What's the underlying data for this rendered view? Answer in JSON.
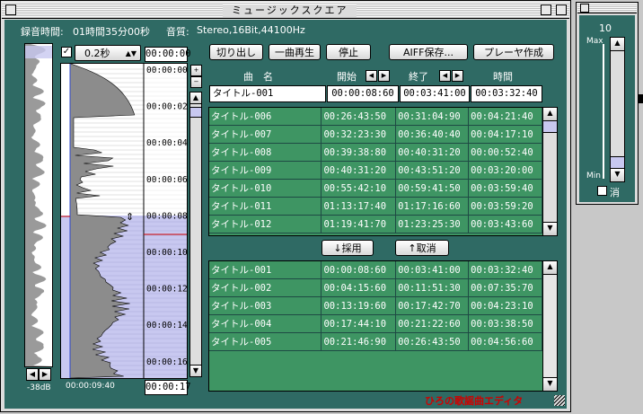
{
  "window": {
    "title": "ミュージックスクエア"
  },
  "info": {
    "record_label": "録音時間:",
    "record_value": "01時間35分00秒",
    "quality_label": "音質:",
    "quality_value": "Stereo,16Bit,44100Hz"
  },
  "interval": {
    "value": "0.2秒",
    "checked": true
  },
  "toolbar": {
    "cut": "切り出し",
    "play_one": "一曲再生",
    "stop": "停止",
    "save_aiff": "AIFF保存...",
    "make_player": "プレーヤ作成"
  },
  "headers": {
    "name": "曲　名",
    "start": "開始",
    "end": "終了",
    "time": "時間"
  },
  "editor": {
    "name": "タイトル-001",
    "start": "00:00:08:60",
    "end": "00:03:41:00",
    "time": "00:03:32:40"
  },
  "timeline": {
    "labels": [
      "00:00:00",
      "00:00:02",
      "00:00:04",
      "00:00:06",
      "00:00:08",
      "00:00:10",
      "00:00:12",
      "00:00:14",
      "00:00:16"
    ],
    "top_time": "00:00:00",
    "bottom_time": "00:00:17",
    "cursor_time": "00:00:09:40",
    "db": "-38dB"
  },
  "upper_list": [
    {
      "name": "タイトル-006",
      "start": "00:26:43:50",
      "end": "00:31:04:90",
      "time": "00:04:21:40"
    },
    {
      "name": "タイトル-007",
      "start": "00:32:23:30",
      "end": "00:36:40:40",
      "time": "00:04:17:10"
    },
    {
      "name": "タイトル-008",
      "start": "00:39:38:80",
      "end": "00:40:31:20",
      "time": "00:00:52:40"
    },
    {
      "name": "タイトル-009",
      "start": "00:40:31:20",
      "end": "00:43:51:20",
      "time": "00:03:20:00"
    },
    {
      "name": "タイトル-010",
      "start": "00:55:42:10",
      "end": "00:59:41:50",
      "time": "00:03:59:40"
    },
    {
      "name": "タイトル-011",
      "start": "01:13:17:40",
      "end": "01:17:16:60",
      "time": "00:03:59:20"
    },
    {
      "name": "タイトル-012",
      "start": "01:19:41:70",
      "end": "01:23:25:30",
      "time": "00:03:43:60"
    }
  ],
  "mid_buttons": {
    "adopt": "↓採用",
    "cancel": "↑取消"
  },
  "lower_list": [
    {
      "name": "タイトル-001",
      "start": "00:00:08:60",
      "end": "00:03:41:00",
      "time": "00:03:32:40",
      "highlight": true
    },
    {
      "name": "タイトル-002",
      "start": "00:04:15:60",
      "end": "00:11:51:30",
      "time": "00:07:35:70"
    },
    {
      "name": "タイトル-003",
      "start": "00:13:19:60",
      "end": "00:17:42:70",
      "time": "00:04:23:10"
    },
    {
      "name": "タイトル-004",
      "start": "00:17:44:10",
      "end": "00:21:22:60",
      "time": "00:03:38:50"
    },
    {
      "name": "タイトル-005",
      "start": "00:21:46:90",
      "end": "00:26:43:50",
      "time": "00:04:56:60"
    }
  ],
  "brand": "ひろの歌謡曲エディタ",
  "volume": {
    "value": "10",
    "max_label": "Max",
    "min_label": "Min",
    "mute_label": "消"
  },
  "colors": {
    "panel": "#2f6a64",
    "row": "#3e9563",
    "highlight_text": "#cc0000",
    "selection": "#c8c8f0"
  }
}
